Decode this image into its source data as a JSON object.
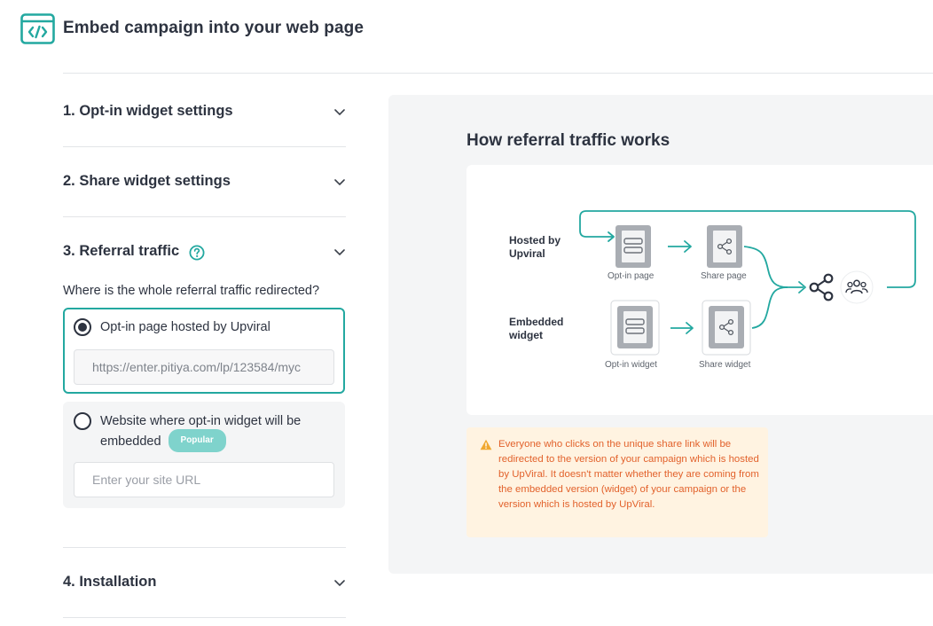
{
  "header": {
    "title": "Embed campaign into your web page"
  },
  "sections": [
    {
      "title": "1. Opt-in widget settings"
    },
    {
      "title": "2. Share widget settings"
    },
    {
      "title": "3. Referral traffic"
    },
    {
      "title": "4. Installation"
    }
  ],
  "referral": {
    "question": "Where is the whole referral traffic redirected?",
    "options": [
      {
        "label": "Opt-in page hosted by Upviral",
        "selected": true,
        "input_value": "https://enter.pitiya.com/lp/123584/myc"
      },
      {
        "label_line1": "Website where opt-in widget will be",
        "label_line2": "embedded",
        "badge": "Popular",
        "selected": false,
        "input_placeholder": "Enter your site URL"
      }
    ]
  },
  "panel": {
    "title": "How referral traffic works",
    "diagram": {
      "row1_label_line1": "Hosted by",
      "row1_label_line2": "Upviral",
      "row2_label_line1": "Embedded",
      "row2_label_line2": "widget",
      "captions": [
        "Opt-in page",
        "Share page",
        "Opt-in widget",
        "Share widget"
      ]
    },
    "warning": "Everyone who clicks on the unique share link will be redirected to the version of your campaign which is hosted by UpViral. It doesn't matter whether they are coming from the embedded version (widget) of your campaign or the version which is hosted by UpViral."
  },
  "colors": {
    "accent": "#23a8a0",
    "warning_text": "#e2622c",
    "warning_bg": "#fff3e1",
    "badge": "#7fd3cc"
  },
  "icons": [
    "code-window-icon",
    "chevron-down-icon",
    "help-circle-icon",
    "layout-page-icon",
    "share-icon",
    "users-icon",
    "warning-icon",
    "arrow-right-icon"
  ]
}
